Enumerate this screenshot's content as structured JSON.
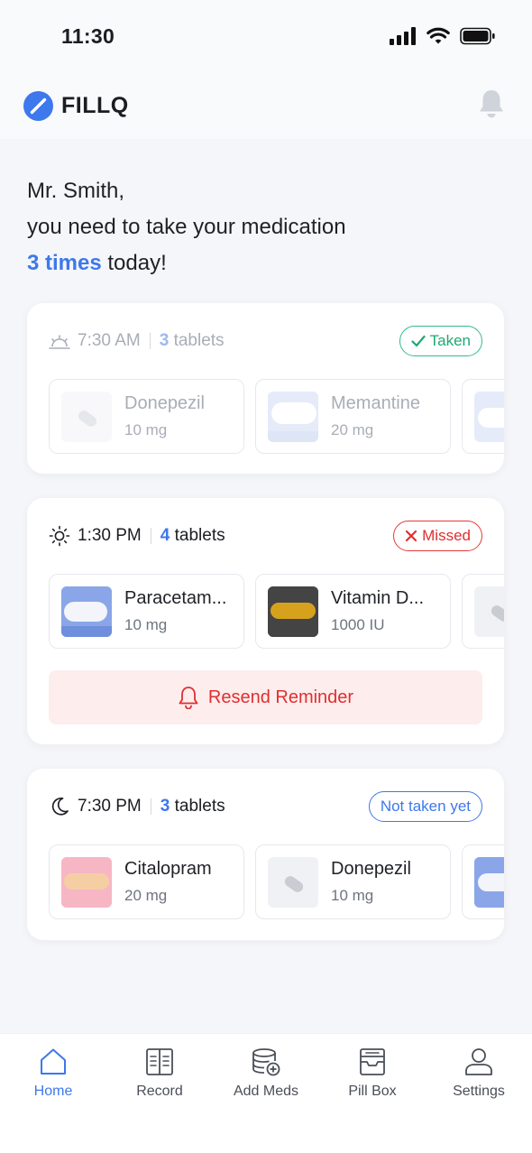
{
  "status_bar": {
    "time": "11:30"
  },
  "app": {
    "name": "FILLQ"
  },
  "greeting": {
    "line1": "Mr. Smith,",
    "line2": "you need to take your medication",
    "times": "3 times",
    "suffix": " today!"
  },
  "schedule": [
    {
      "time": "7:30 AM",
      "count": "3",
      "count_label": " tablets",
      "status": "Taken",
      "meds": [
        {
          "name": "Donepezil",
          "dose": "10 mg"
        },
        {
          "name": "Memantine",
          "dose": "20 mg"
        }
      ]
    },
    {
      "time": "1:30 PM",
      "count": "4",
      "count_label": " tablets",
      "status": "Missed",
      "meds": [
        {
          "name": "Paracetam...",
          "dose": "10 mg"
        },
        {
          "name": "Vitamin D...",
          "dose": "1000 IU"
        }
      ],
      "action": "Resend Reminder"
    },
    {
      "time": "7:30 PM",
      "count": "3",
      "count_label": " tablets",
      "status": "Not taken yet",
      "meds": [
        {
          "name": "Citalopram",
          "dose": "20 mg"
        },
        {
          "name": "Donepezil",
          "dose": "10 mg"
        }
      ]
    }
  ],
  "tabs": [
    {
      "label": "Home",
      "icon": "home-icon",
      "active": true
    },
    {
      "label": "Record",
      "icon": "record-icon"
    },
    {
      "label": "Add Meds",
      "icon": "add-meds-icon"
    },
    {
      "label": "Pill Box",
      "icon": "pill-box-icon"
    },
    {
      "label": "Settings",
      "icon": "user-icon"
    }
  ],
  "colors": {
    "accent": "#3d78ec",
    "taken": "#1fa873",
    "missed": "#e02f2f",
    "background": "#f5f6f9"
  }
}
